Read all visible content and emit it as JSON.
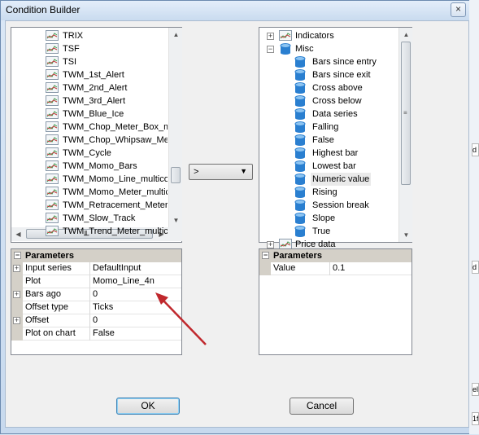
{
  "window": {
    "title": "Condition Builder",
    "close_glyph": "×"
  },
  "left_list": {
    "items": [
      "TRIX",
      "TSF",
      "TSI",
      "TWM_1st_Alert",
      "TWM_2nd_Alert",
      "TWM_3rd_Alert",
      "TWM_Blue_Ice",
      "TWM_Chop_Meter_Box_m",
      "TWM_Chop_Whipsaw_Me",
      "TWM_Cycle",
      "TWM_Momo_Bars",
      "TWM_Momo_Line_multico",
      "TWM_Momo_Meter_multic",
      "TWM_Retracement_Meter",
      "TWM_Slow_Track",
      "TWM_Trend_Meter_multic"
    ],
    "scroll_grip": "III"
  },
  "operator_select": {
    "value": ">"
  },
  "right_tree": {
    "indicators_label": "Indicators",
    "misc_label": "Misc",
    "misc_items": [
      "Bars since entry",
      "Bars since exit",
      "Cross above",
      "Cross below",
      "Data series",
      "Falling",
      "False",
      "Highest bar",
      "Lowest bar",
      "Numeric value",
      "Rising",
      "Session break",
      "Slope",
      "True"
    ],
    "price_data_label": "Price data"
  },
  "left_params": {
    "header": "Parameters",
    "rows": [
      {
        "name": "Input series",
        "value": "DefaultInput",
        "expandable": true
      },
      {
        "name": "Plot",
        "value": "Momo_Line_4n",
        "expandable": false
      },
      {
        "name": "Bars ago",
        "value": "0",
        "expandable": true
      },
      {
        "name": "Offset type",
        "value": "Ticks",
        "expandable": false
      },
      {
        "name": "Offset",
        "value": "0",
        "expandable": true
      },
      {
        "name": "Plot on chart",
        "value": "False",
        "expandable": false
      }
    ]
  },
  "right_params": {
    "header": "Parameters",
    "rows": [
      {
        "name": "Value",
        "value": "0.1"
      }
    ]
  },
  "buttons": {
    "ok": "OK",
    "cancel": "Cancel"
  },
  "annotation": {
    "arrow_color": "#c0282d"
  },
  "behind_window": {
    "fragments": [
      "d",
      "d",
      "el",
      "1f"
    ]
  },
  "colors": {
    "db_icon": "#2a7fd0",
    "title_bar": "#c9dbef"
  }
}
